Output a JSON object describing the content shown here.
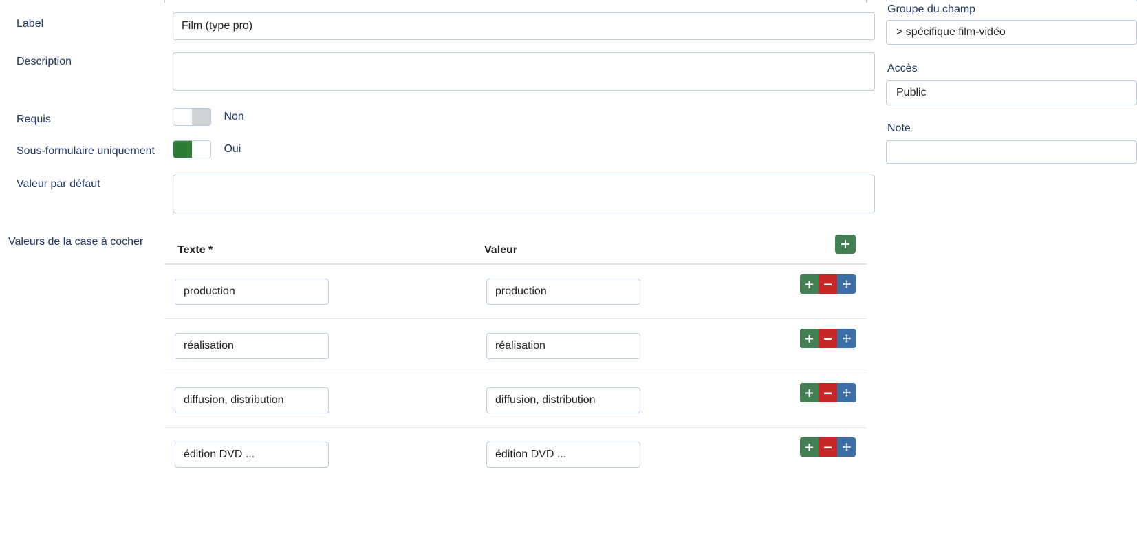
{
  "form": {
    "fields": [
      {
        "label": "Label",
        "value": "Film (type pro)",
        "placeholder": ""
      },
      {
        "label": "Description",
        "value": "",
        "placeholder": ""
      },
      {
        "label": "Requis",
        "state_text": "Non",
        "state": "off"
      },
      {
        "label": "Sous-formulaire uniquement",
        "state_text": "Oui",
        "state": "on"
      },
      {
        "label": "Valeur par défaut",
        "value": "",
        "placeholder": ""
      }
    ],
    "values_label": "Valeurs de la case à cocher"
  },
  "values_table": {
    "columns": [
      "Texte *",
      "Valeur"
    ],
    "add_row_icon": "plus-icon",
    "rows": [
      {
        "texte": "production",
        "valeur": "production"
      },
      {
        "texte": "réalisation",
        "valeur": "réalisation"
      },
      {
        "texte": "diffusion, distribution",
        "valeur": "diffusion, distribution"
      },
      {
        "texte": "édition DVD ...",
        "valeur": "édition DVD ..."
      }
    ],
    "row_actions": [
      {
        "name": "add-row-button",
        "icon": "plus-icon",
        "color": "#428054"
      },
      {
        "name": "remove-row-button",
        "icon": "minus-icon",
        "color": "#c62828"
      },
      {
        "name": "move-row-button",
        "icon": "move-arrows-icon",
        "color": "#3a6ea5"
      }
    ]
  },
  "sidebar": {
    "field_group": {
      "label": "Groupe du champ",
      "value": "> spécifique film-vidéo"
    },
    "access": {
      "label": "Accès",
      "value": "Public"
    },
    "note": {
      "label": "Note",
      "value": "",
      "placeholder": ""
    }
  },
  "colors": {
    "green": "#428054",
    "toggle_green": "#2e7d32",
    "red": "#c62828",
    "blue": "#3a6ea5",
    "border": "#b8cce0",
    "label_text": "#1f3864"
  }
}
